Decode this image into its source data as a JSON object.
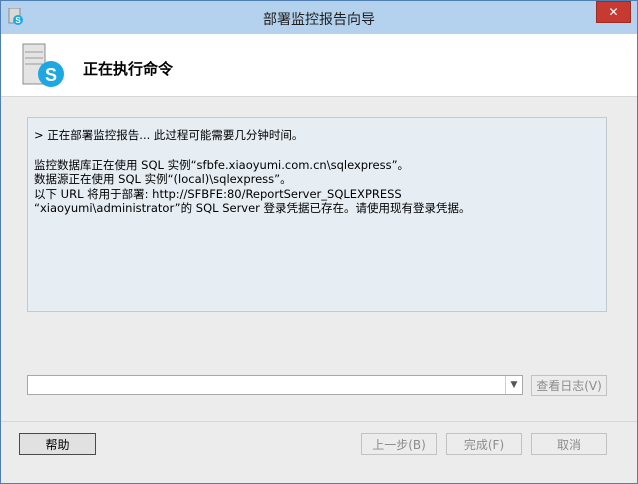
{
  "window": {
    "title": "部署监控报告向导",
    "close_label": "✕"
  },
  "header": {
    "title": "正在执行命令"
  },
  "log": {
    "line1": "> 正在部署监控报告... 此过程可能需要几分钟时间。",
    "line2": "监控数据库正在使用 SQL 实例“sfbfe.xiaoyumi.com.cn\\sqlexpress”。",
    "line3": "数据源正在使用 SQL 实例“(local)\\sqlexpress”。",
    "line4": "以下 URL 将用于部署: http://SFBFE:80/ReportServer_SQLEXPRESS",
    "line5": "“xiaoyumi\\administrator”的 SQL Server 登录凭据已存在。请使用现有登录凭据。"
  },
  "log_selector": {
    "value": "",
    "view_log_label": "查看日志(V)"
  },
  "footer": {
    "help_label": "帮助",
    "back_label": "上一步(B)",
    "finish_label": "完成(F)",
    "cancel_label": "取消"
  },
  "colors": {
    "titlebar": "#b4d2ed",
    "close": "#c73a31",
    "log_bg": "#e6edf3",
    "skype_blue": "#1ea7e1"
  },
  "icons": {
    "app": "skype-server-icon",
    "header": "skype-server-icon",
    "close": "close-icon",
    "dropdown": "chevron-down-icon"
  }
}
